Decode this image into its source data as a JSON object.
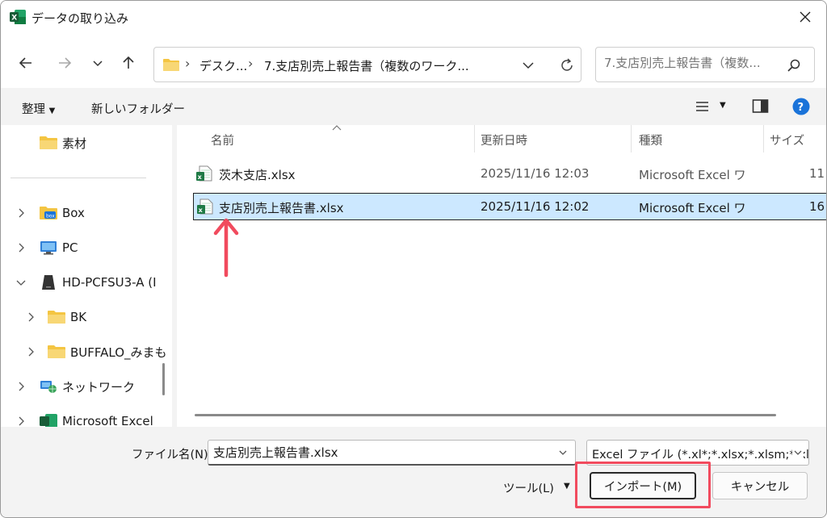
{
  "window": {
    "title": "データの取り込み",
    "app_icon": "excel-icon"
  },
  "nav": {
    "breadcrumbs": [
      "デスク...",
      "7.支店別売上報告書（複数のワーク..."
    ],
    "search_placeholder": "7.支店別売上報告書（複数..."
  },
  "commandbar": {
    "organize": "整理",
    "new_folder": "新しいフォルダー"
  },
  "sidebar": {
    "items": [
      {
        "label": "素材",
        "icon": "folder-icon"
      },
      {
        "label": "Box",
        "icon": "box-icon"
      },
      {
        "label": "PC",
        "icon": "pc-icon"
      },
      {
        "label": "HD-PCFSU3-A (I",
        "icon": "drive-icon"
      },
      {
        "label": "BK",
        "icon": "folder-icon"
      },
      {
        "label": "BUFFALO_みまも",
        "icon": "folder-icon"
      },
      {
        "label": "ネットワーク",
        "icon": "network-icon"
      },
      {
        "label": "Microsoft Excel",
        "icon": "excel-icon"
      }
    ]
  },
  "filelist": {
    "columns": [
      "名前",
      "更新日時",
      "種類",
      "サイズ"
    ],
    "rows": [
      {
        "name": "茨木支店.xlsx",
        "modified": "2025/11/16 12:03",
        "type": "Microsoft Excel ワ",
        "size": "11",
        "selected": false
      },
      {
        "name": "支店別売上報告書.xlsx",
        "modified": "2025/11/16 12:02",
        "type": "Microsoft Excel ワ",
        "size": "16",
        "selected": true
      }
    ]
  },
  "footer": {
    "filename_label": "ファイル名(N):",
    "filename_value": "支店別売上報告書.xlsx",
    "filter": "Excel ファイル (*.xl*;*.xlsx;*.xlsm;*.xls",
    "tools": "ツール(L)",
    "import": "インポート(M)",
    "cancel": "キャンセル"
  },
  "colors": {
    "selection": "#cce8ff",
    "annotation": "#f14b5e",
    "excel_green": "#1f7a45",
    "folder": "#f4c542"
  }
}
